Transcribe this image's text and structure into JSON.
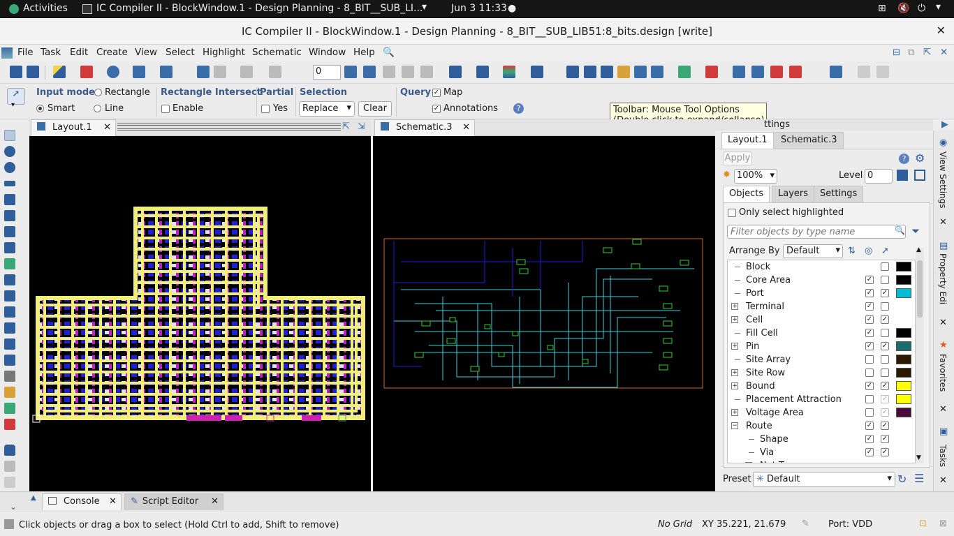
{
  "topbar": {
    "activities": "Activities",
    "app": "IC Compiler II - BlockWindow.1 - Design Planning - 8_BIT__SUB_LI...",
    "clock": "Jun 3  11:33"
  },
  "window": {
    "title": "IC Compiler II - BlockWindow.1 - Design Planning - 8_BIT__SUB_LIB51:8_bits.design [write]"
  },
  "menu": {
    "file": "File",
    "task": "Task",
    "edit": "Edit",
    "create": "Create",
    "view": "View",
    "select": "Select",
    "highlight": "Highlight",
    "schematic": "Schematic",
    "window": "Window",
    "help": "Help"
  },
  "toolbar": {
    "spin_value": "0"
  },
  "options": {
    "input_mode": "Input mode",
    "rectangle": "Rectangle",
    "smart": "Smart",
    "line": "Line",
    "rect_intersect": "Rectangle Intersect",
    "enable": "Enable",
    "partial": "Partial",
    "yes": "Yes",
    "selection": "Selection",
    "replace": "Replace",
    "clear": "Clear",
    "query": "Query",
    "map": "Map",
    "annotations": "Annotations"
  },
  "tooltip": {
    "line1": "Toolbar: Mouse Tool Options",
    "line2": "(Double click to expand/collapse)"
  },
  "panes": {
    "layout_tab": "Layout.1",
    "schematic_tab": "Schematic.3"
  },
  "view_settings": {
    "title_frag": "ttings",
    "tabs": [
      "Layout.1",
      "Schematic.3"
    ],
    "apply": "Apply",
    "zoom": "100%",
    "level_label": "Level",
    "level_value": "0",
    "subtabs": [
      "Objects",
      "Layers",
      "Settings"
    ],
    "only_highlighted": "Only select highlighted",
    "filter_placeholder": "Filter objects by type name",
    "arrange_by": "Arrange By",
    "arrange_value": "Default",
    "rows": [
      {
        "name": "Block",
        "expand": false,
        "indent": 0,
        "vis": "",
        "sel": "off",
        "swatch": "#000000"
      },
      {
        "name": "Core Area",
        "expand": false,
        "indent": 0,
        "vis": "on",
        "sel": "off",
        "swatch": "#000000"
      },
      {
        "name": "Port",
        "expand": false,
        "indent": 0,
        "vis": "on",
        "sel": "on",
        "swatch": "#00bcd4"
      },
      {
        "name": "Terminal",
        "expand": true,
        "indent": 0,
        "vis": "on",
        "sel": "off",
        "swatch": ""
      },
      {
        "name": "Cell",
        "expand": true,
        "indent": 0,
        "vis": "on",
        "sel": "on",
        "swatch": ""
      },
      {
        "name": "Fill Cell",
        "expand": false,
        "indent": 0,
        "vis": "on",
        "sel": "off",
        "swatch": "#000000"
      },
      {
        "name": "Pin",
        "expand": true,
        "indent": 0,
        "vis": "on",
        "sel": "on",
        "swatch": "#1a6b6b"
      },
      {
        "name": "Site Array",
        "expand": false,
        "indent": 0,
        "vis": "off",
        "sel": "off",
        "swatch": "#2a1a00"
      },
      {
        "name": "Site Row",
        "expand": true,
        "indent": 0,
        "vis": "off",
        "sel": "off",
        "swatch": "#2a1a00"
      },
      {
        "name": "Bound",
        "expand": true,
        "indent": 0,
        "vis": "on",
        "sel": "on",
        "swatch": "#ffff00"
      },
      {
        "name": "Placement Attraction",
        "expand": false,
        "indent": 0,
        "vis": "off",
        "sel": "dim",
        "swatch": "#ffff00"
      },
      {
        "name": "Voltage Area",
        "expand": true,
        "indent": 0,
        "vis": "off",
        "sel": "dim",
        "swatch": "#4a0a3a"
      },
      {
        "name": "Route",
        "expand": "open",
        "indent": 0,
        "vis": "on",
        "sel": "on",
        "swatch": ""
      },
      {
        "name": "Shape",
        "expand": false,
        "indent": 1,
        "vis": "on",
        "sel": "on",
        "swatch": ""
      },
      {
        "name": "Via",
        "expand": false,
        "indent": 1,
        "vis": "on",
        "sel": "on",
        "swatch": ""
      },
      {
        "name": "Net Type",
        "expand": true,
        "indent": 1,
        "vis": "",
        "sel": "",
        "swatch": ""
      }
    ],
    "preset_label": "Preset",
    "preset_value": "Default"
  },
  "side_tabs": [
    "View Settings",
    "Property Edi",
    "Favorites",
    "Tasks"
  ],
  "bottom_tabs": {
    "console": "Console",
    "script_editor": "Script Editor"
  },
  "status": {
    "hint": "Click objects or drag a box to select (Hold Ctrl to add, Shift to remove)",
    "grid": "No Grid",
    "xy": "XY 35.221, 21.679",
    "port": "Port: VDD"
  }
}
